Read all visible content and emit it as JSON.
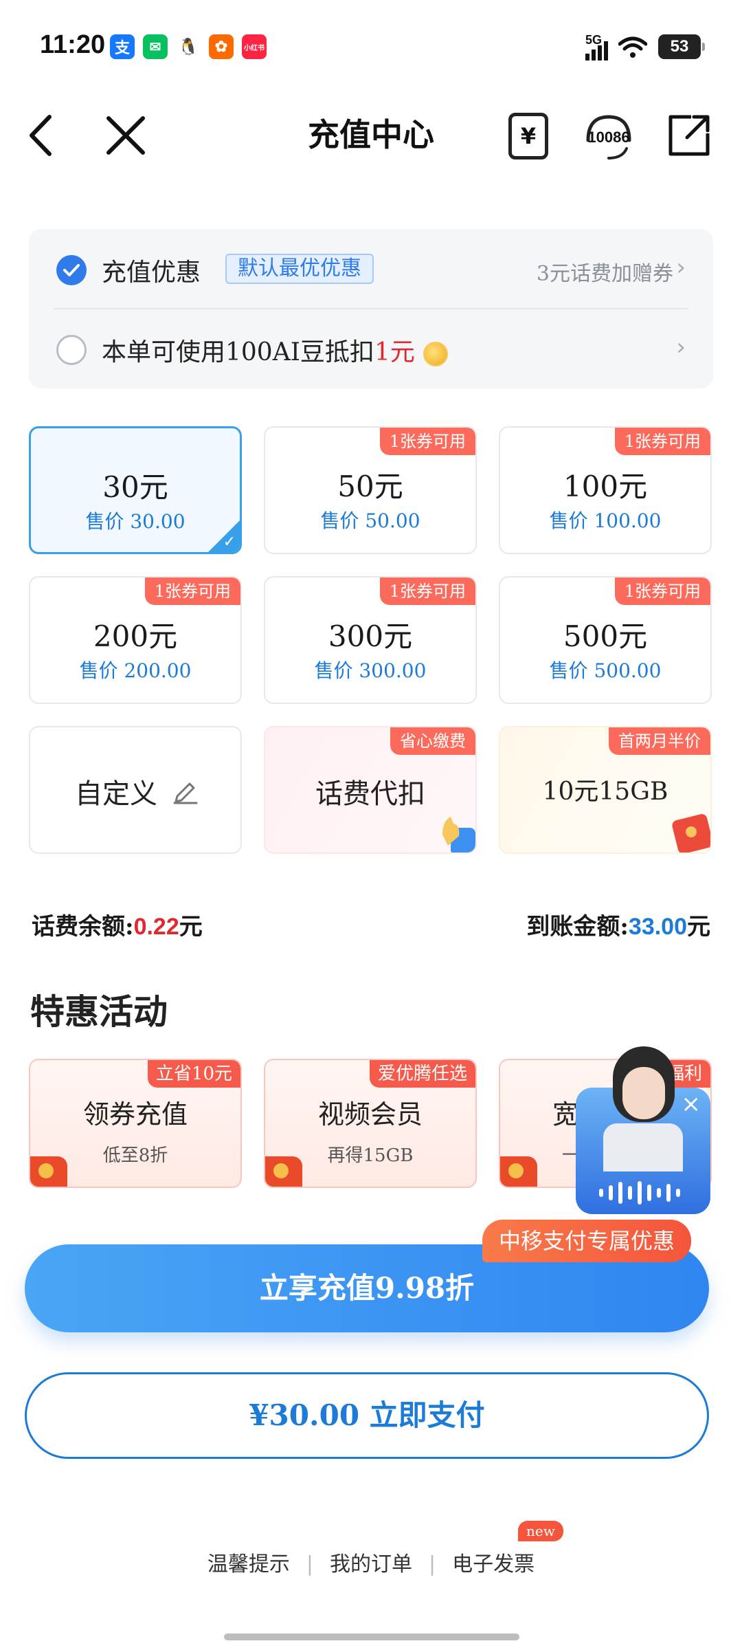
{
  "status_bar": {
    "time": "11:20",
    "notifications": [
      {
        "icon": "alipay-icon",
        "glyph": "支",
        "color": "#1677ff"
      },
      {
        "icon": "wechat-icon",
        "glyph": "✉",
        "color": "#07c160"
      },
      {
        "icon": "qq-icon",
        "glyph": "🐧",
        "color": "#ffffff"
      },
      {
        "icon": "taobao-icon",
        "glyph": "✿",
        "color": "#ff6a00"
      },
      {
        "icon": "xiaohongshu-icon",
        "glyph": "小红书",
        "color": "#ff2442"
      }
    ],
    "network": "5G",
    "battery": "53"
  },
  "header": {
    "title": "充值中心",
    "service_number": "10086",
    "bill_glyph": "¥"
  },
  "promo": {
    "row1": {
      "label": "充值优惠",
      "badge": "默认最优优惠",
      "right_text": "3元话费加赠券"
    },
    "row2": {
      "prefix": "本单可使用100AI豆抵扣",
      "amount": "1元"
    },
    "chevron": "›"
  },
  "amounts": [
    {
      "amount": "30元",
      "price": "售价 30.00",
      "tag": ""
    },
    {
      "amount": "50元",
      "price": "售价 50.00",
      "tag": "1张券可用"
    },
    {
      "amount": "100元",
      "price": "售价 100.00",
      "tag": "1张券可用"
    },
    {
      "amount": "200元",
      "price": "售价 200.00",
      "tag": "1张券可用"
    },
    {
      "amount": "300元",
      "price": "售价 300.00",
      "tag": "1张券可用"
    },
    {
      "amount": "500元",
      "price": "售价 500.00",
      "tag": "1张券可用"
    }
  ],
  "extra_cards": [
    {
      "label": "自定义",
      "tag": ""
    },
    {
      "label": "话费代扣",
      "tag": "省心缴费"
    },
    {
      "label": "10元15GB",
      "tag": "首两月半价"
    }
  ],
  "balance": {
    "label": "话费余额:",
    "value": "0.22",
    "unit": "元"
  },
  "arrival": {
    "label": "到账金额:",
    "value": "33.00",
    "unit": "元"
  },
  "specials": {
    "title": "特惠活动",
    "cards": [
      {
        "title": "领券充值",
        "sub": "低至8折",
        "tag": "立省10元"
      },
      {
        "title": "视频会员",
        "sub": "再得15GB",
        "tag": "爱优腾任选"
      },
      {
        "title": "宽",
        "sub": "一",
        "tag": "福利"
      }
    ]
  },
  "assistant": {
    "close": "×"
  },
  "cta": {
    "label": "立享充值9.98折",
    "tag": "中移支付专属优惠"
  },
  "pay": {
    "label": "¥30.00  立即支付"
  },
  "footer": {
    "links": [
      "温馨提示",
      "我的订单",
      "电子发票"
    ],
    "new_badge": "new"
  },
  "colors": {
    "primary": "#2f7bea",
    "price_blue": "#1b7bd6",
    "coupon_red": "#fb6a5a",
    "balance_red": "#e0292e"
  }
}
